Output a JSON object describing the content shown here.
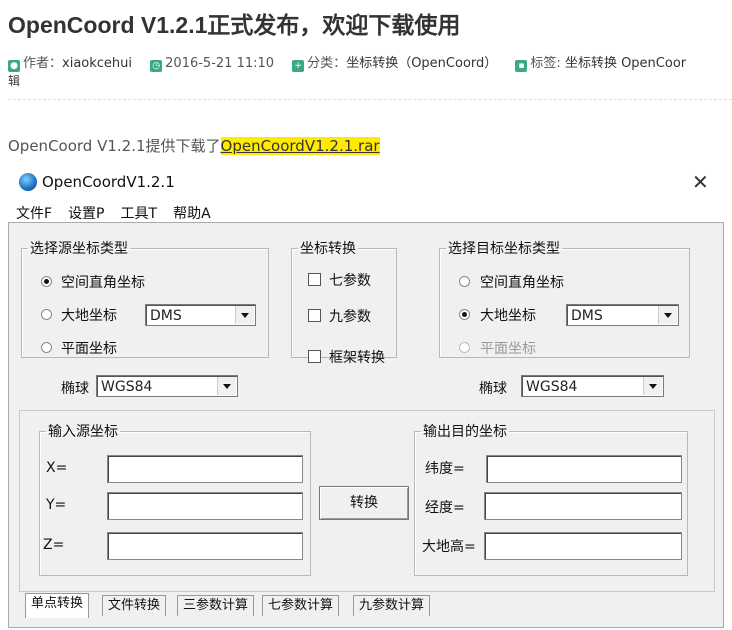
{
  "article": {
    "title": "OpenCoord V1.2.1正式发布，欢迎下载使用",
    "author_label": "作者：",
    "author": "xiaokcehui",
    "date": "2016-5-21 11:10",
    "category_label": "分类：",
    "category": "坐标转换（OpenCoord）",
    "tags_label": "标签:",
    "tags": "坐标转换 OpenCoor",
    "tags_wrap": "辑",
    "intro_text": "OpenCoord V1.2.1提供下载了",
    "download_link": "OpenCoordV1.2.1.rar"
  },
  "window": {
    "title": "OpenCoordV1.2.1",
    "close": "✕",
    "menu": [
      "文件F",
      "设置P",
      "工具T",
      "帮助A"
    ]
  },
  "source_type": {
    "legend": "选择源坐标类型",
    "options": [
      "空间直角坐标",
      "大地坐标",
      "平面坐标"
    ],
    "selected": 0,
    "format_value": "DMS"
  },
  "conversion": {
    "legend": "坐标转换",
    "options": [
      "七参数",
      "九参数",
      "框架转换"
    ]
  },
  "target_type": {
    "legend": "选择目标坐标类型",
    "options": [
      "空间直角坐标",
      "大地坐标",
      "平面坐标"
    ],
    "selected": 1,
    "format_value": "DMS"
  },
  "ellipsoid": {
    "source_label": "椭球",
    "source_value": "WGS84",
    "target_label": "椭球",
    "target_value": "WGS84"
  },
  "input": {
    "legend": "输入源坐标",
    "labels": [
      "X=",
      "Y=",
      "Z="
    ]
  },
  "convert_button": "转换",
  "output": {
    "legend": "输出目的坐标",
    "labels": [
      "纬度=",
      "经度=",
      "大地高="
    ]
  },
  "tabs": [
    "单点转换",
    "文件转换",
    "三参数计算",
    "七参数计算",
    "九参数计算"
  ],
  "colors": {
    "link_highlight": "#ffea00",
    "meta_icon": "#3aaa85"
  }
}
